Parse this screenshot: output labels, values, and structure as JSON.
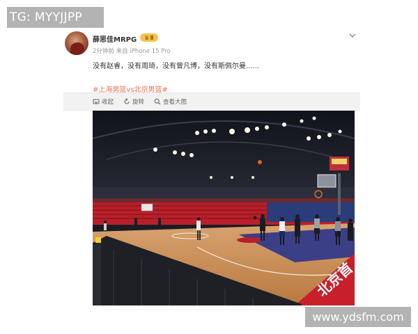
{
  "overlay": {
    "tg_label": "TG: MYYJJPP",
    "site_watermark": "www.ydsfm.com"
  },
  "post": {
    "author": {
      "name": "薛思佳MRPG",
      "badge": "8"
    },
    "meta": {
      "time": "2分钟前",
      "source": "来自 iPhone 15 Pro"
    },
    "text": "没有赵睿，没有周琦，没有曾凡博，没有斯佩尔曼......",
    "hashtag": "#上海男篮vs北京男篮#",
    "actions": {
      "favorite": "收起",
      "rotate": "旋转",
      "view_large": "查看大图"
    },
    "photo": {
      "scoreboard_text": "",
      "court_banner": "北京首"
    }
  },
  "colors": {
    "hashtag": "#eb7350",
    "badge": "#f3c34a",
    "court_wood": "#c98a52",
    "arena_red": "#b8202a"
  },
  "icons": [
    "more-chevron-icon",
    "favorite-icon",
    "rotate-icon",
    "zoom-icon",
    "crown-icon"
  ]
}
